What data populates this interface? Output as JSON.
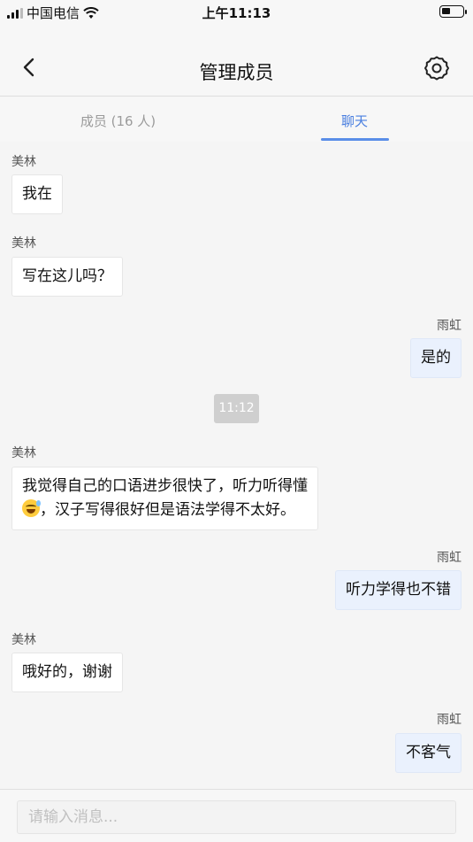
{
  "status_bar": {
    "carrier": "中国电信",
    "time": "上午11:13"
  },
  "navbar": {
    "title": "管理成员"
  },
  "tabs": [
    {
      "label": "成员 (16 人)"
    },
    {
      "label": "聊天"
    }
  ],
  "messages": [
    {
      "sender": "美林",
      "text": "我在"
    },
    {
      "sender": "美林",
      "text": "写在这儿吗？"
    },
    {
      "sender": "雨虹",
      "text": "是的"
    },
    {
      "sender": "美林",
      "text_line1": "我觉得自己的口语进步很快了，听力听得懂",
      "text_line2": "，汉子写得很好但是语法学得不太好。"
    },
    {
      "sender": "雨虹",
      "text": "听力学得也不错"
    },
    {
      "sender": "美林",
      "text": "哦好的，谢谢"
    },
    {
      "sender": "雨虹",
      "text": "不客气"
    }
  ],
  "timestamp": "11:12",
  "input": {
    "placeholder": "请输入消息..."
  },
  "colors": {
    "accent": "#4a7fe0",
    "my_bubble": "#eaf1fd",
    "other_bubble": "#ffffff"
  }
}
